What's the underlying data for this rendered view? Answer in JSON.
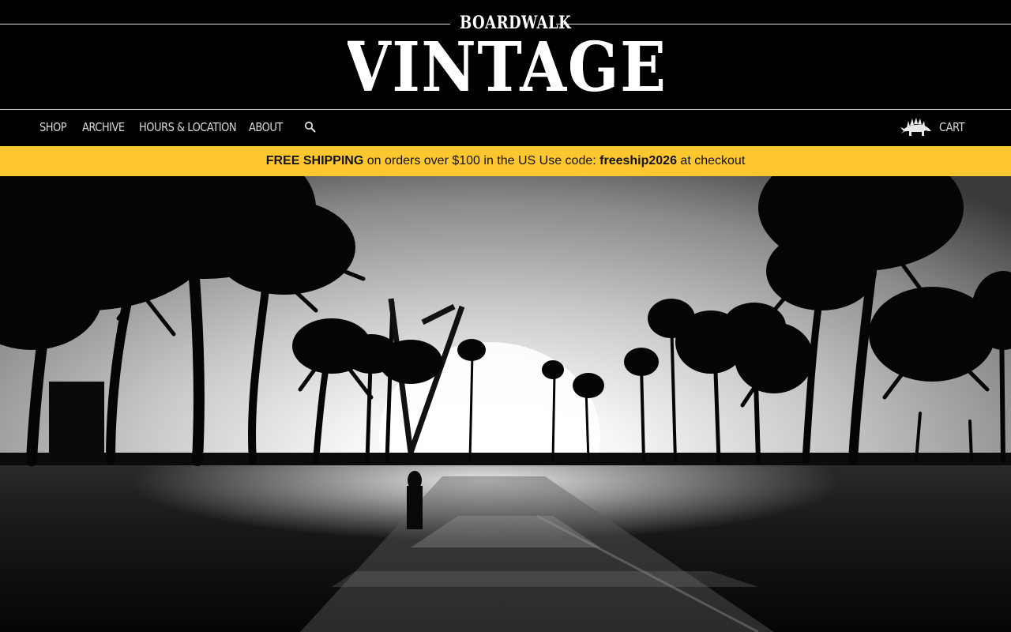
{
  "brand": {
    "small": "BOARDWALK",
    "big": "VINTAGE"
  },
  "nav": {
    "items": [
      {
        "label": "SHOP"
      },
      {
        "label": "ARCHIVE"
      },
      {
        "label": "HOURS & LOCATION"
      },
      {
        "label": "ABOUT"
      }
    ],
    "search_icon": "search-icon",
    "cart_icon": "stegosaurus-icon",
    "cart_label": "CART"
  },
  "promo": {
    "lead": "FREE SHIPPING",
    "middle": " on orders over $100 in the US Use code: ",
    "code": "freeship2026",
    "tail": " at checkout"
  },
  "hero": {
    "image": "black-and-white sunset boardwalk with palm trees"
  },
  "colors": {
    "background": "#000000",
    "banner": "#fec72f",
    "nav_text": "#d9d9d9"
  }
}
